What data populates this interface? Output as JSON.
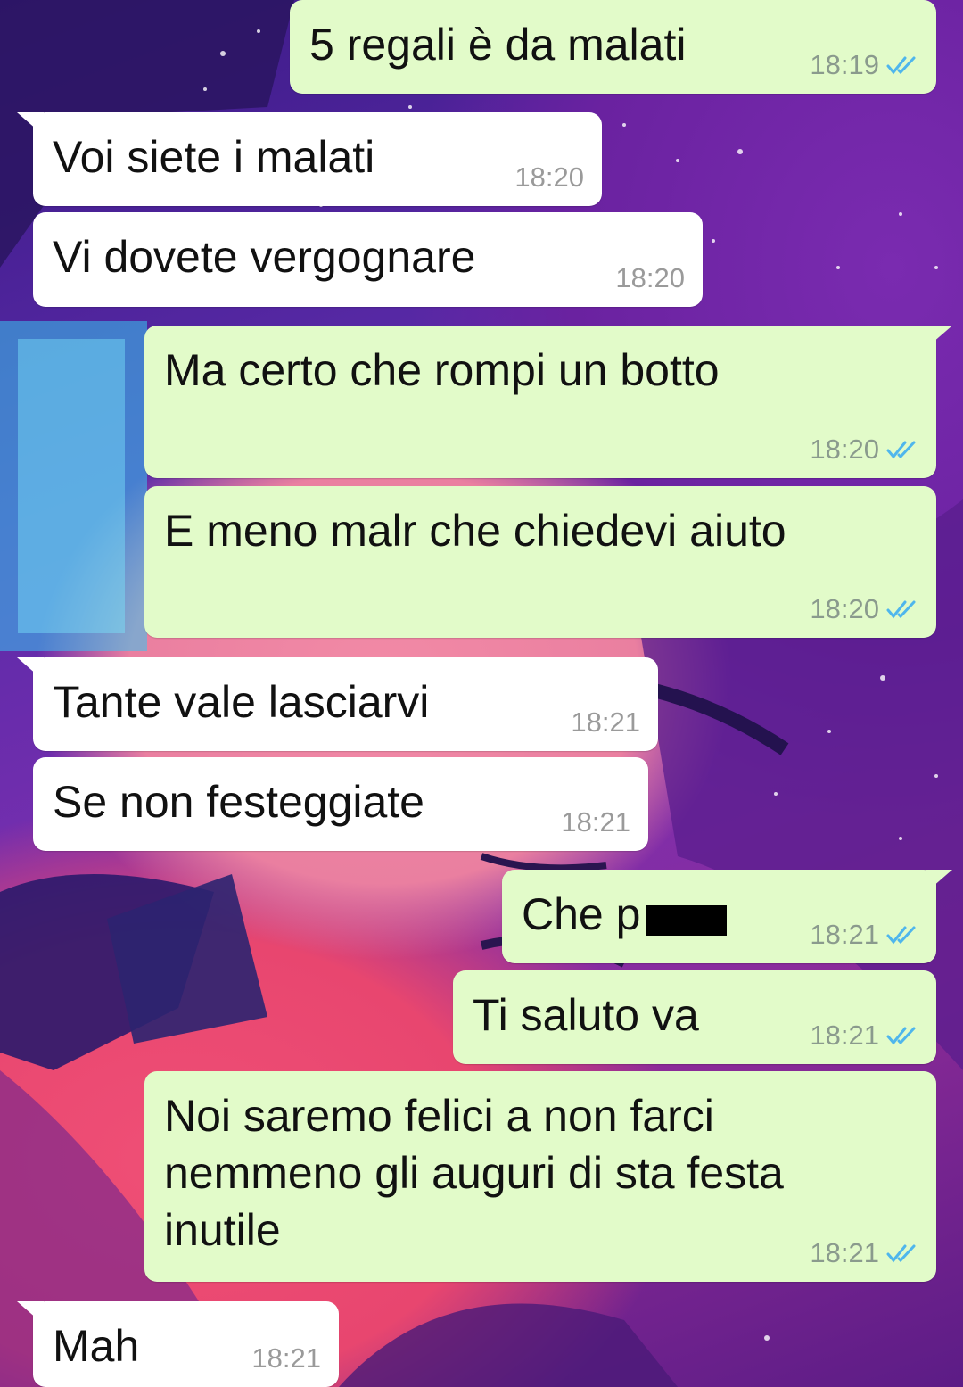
{
  "colors": {
    "incoming_bubble": "#ffffff",
    "outgoing_bubble": "#e2fbc9",
    "read_ticks": "#4fb6ec"
  },
  "messages": [
    {
      "dir": "out",
      "text": "5 regali è da malati",
      "time": "18:19",
      "status": "read"
    },
    {
      "dir": "in",
      "text": "Voi siete i malati",
      "time": "18:20"
    },
    {
      "dir": "in",
      "text": "Vi dovete vergognare",
      "time": "18:20"
    },
    {
      "dir": "out",
      "text": "Ma certo che rompi un botto",
      "time": "18:20",
      "status": "read"
    },
    {
      "dir": "out",
      "text": "E meno malr che chiedevi aiuto",
      "time": "18:20",
      "status": "read"
    },
    {
      "dir": "in",
      "text": "Tante vale lasciarvi",
      "time": "18:21"
    },
    {
      "dir": "in",
      "text": "Se non festeggiate",
      "time": "18:21"
    },
    {
      "dir": "out",
      "text": "Che p",
      "time": "18:21",
      "status": "read",
      "redacted": true
    },
    {
      "dir": "out",
      "text": "Ti saluto va",
      "time": "18:21",
      "status": "read"
    },
    {
      "dir": "out",
      "text": "Noi saremo felici a non farci\nnemmeno gli auguri di sta festa\ninutile",
      "time": "18:21",
      "status": "read"
    },
    {
      "dir": "in",
      "text": "Mah",
      "time": "18:21"
    }
  ]
}
